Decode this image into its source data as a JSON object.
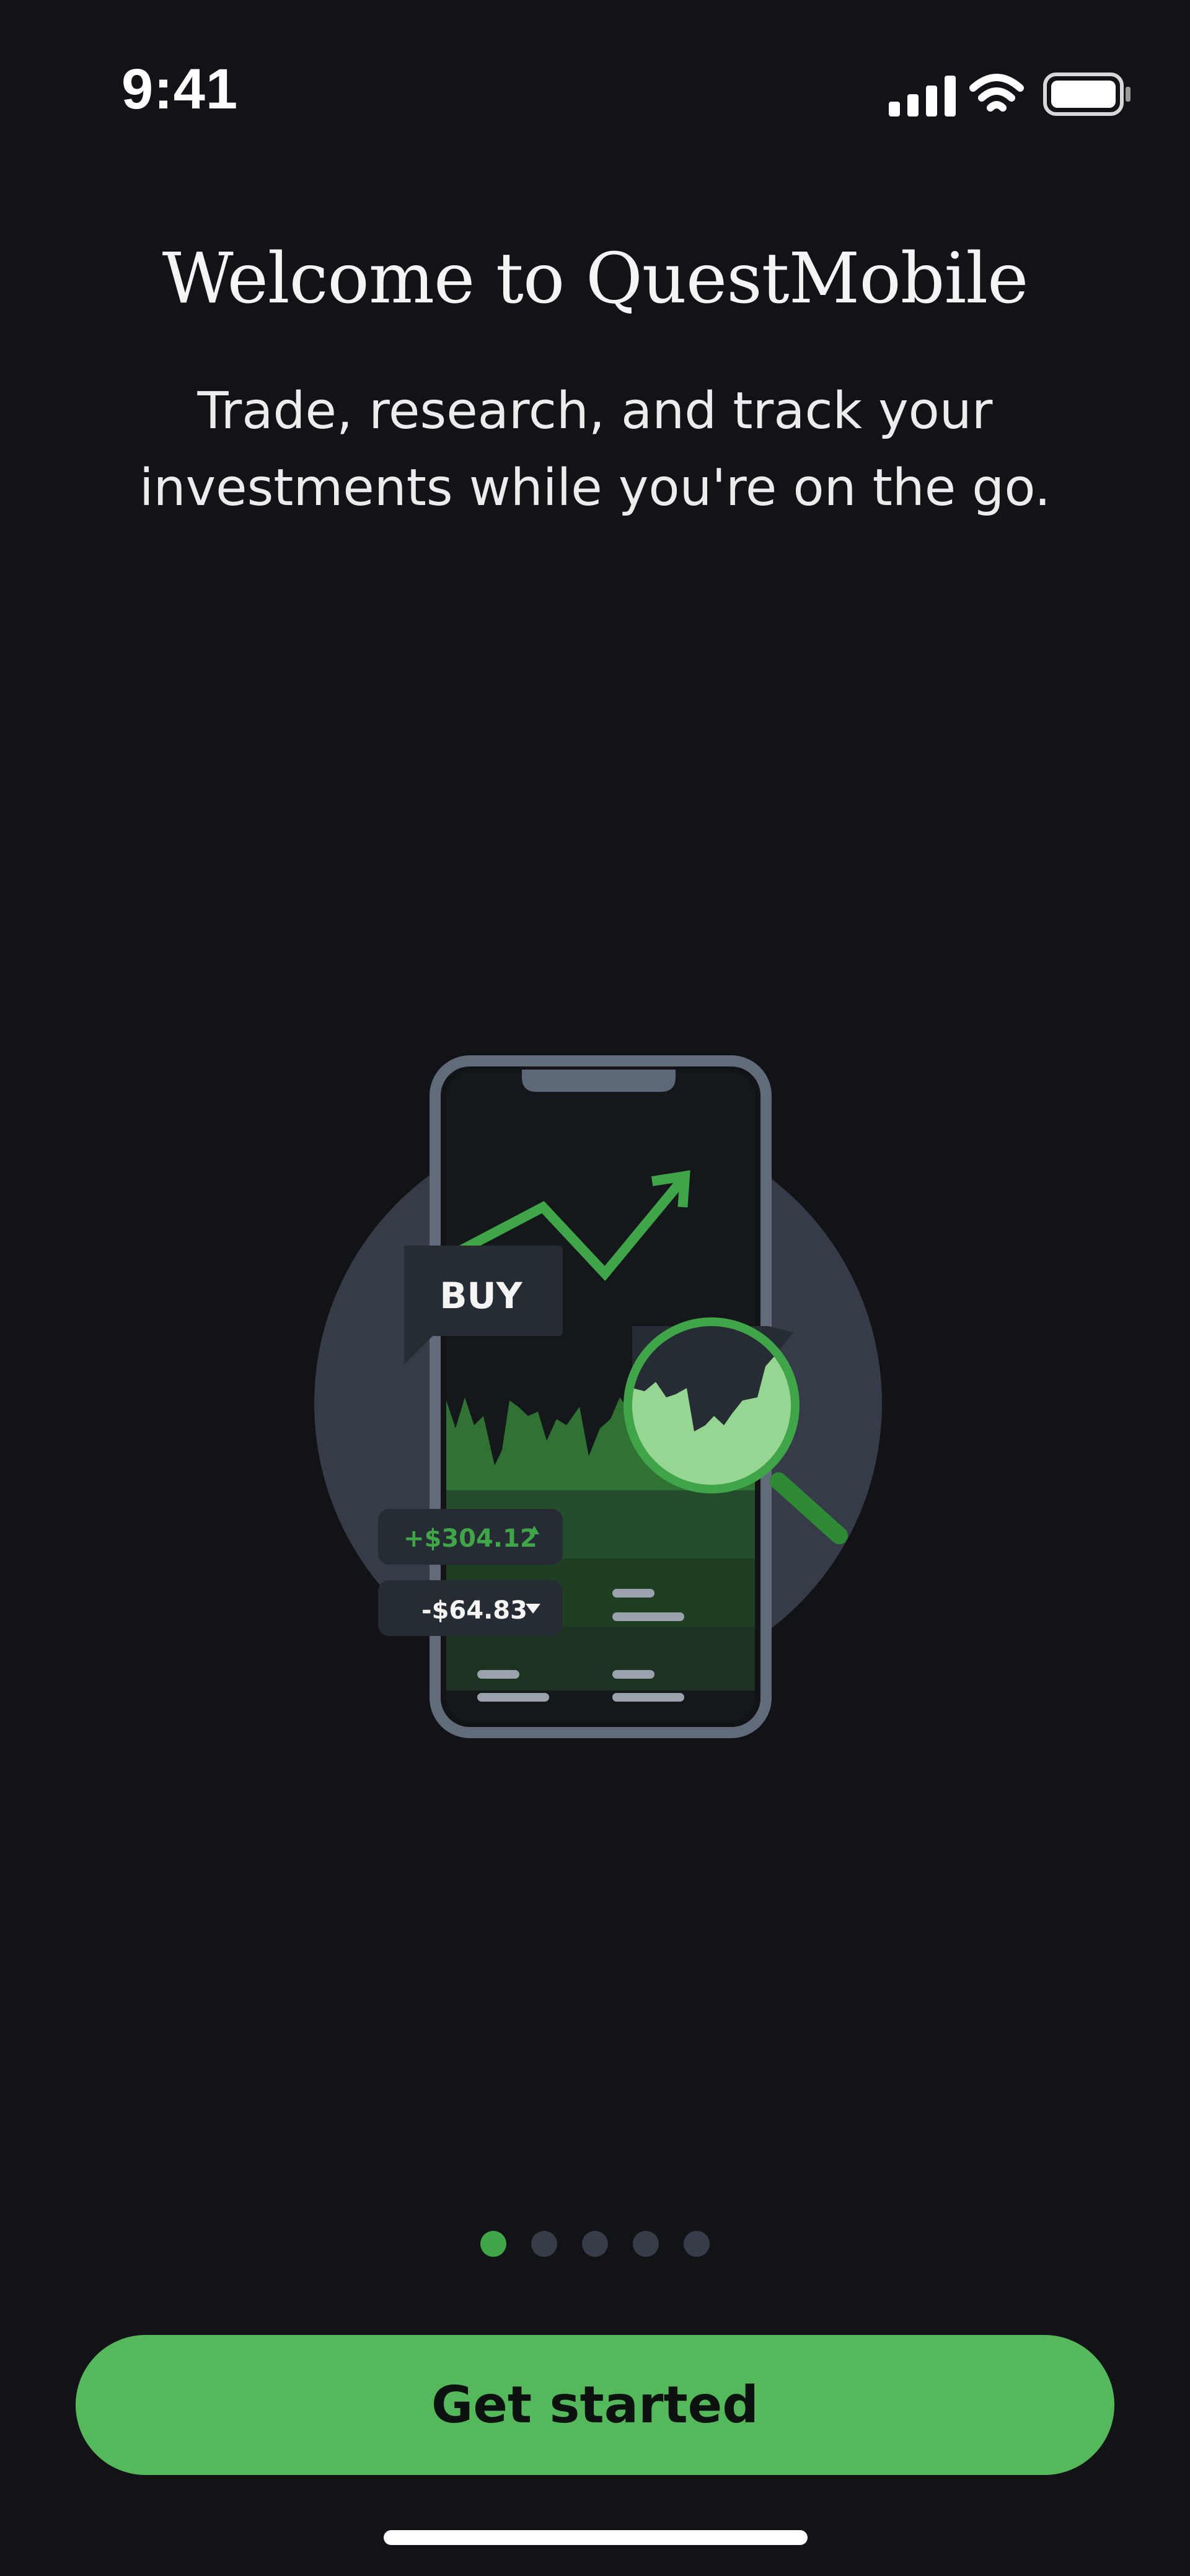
{
  "status_bar": {
    "time": "9:41"
  },
  "onboarding": {
    "title": "Welcome to QuestMobile",
    "subtitle": "Trade, research, and track your investments while you're on the go.",
    "current_page": 1,
    "page_count": 5,
    "cta_label": "Get started"
  },
  "illustration": {
    "buy_label": "BUY",
    "gain_label": "+$304.12",
    "loss_label": "-$64.83"
  },
  "colors": {
    "background": "#121316",
    "accent_green": "#55b95b",
    "dot_inactive": "#363c48"
  },
  "icons": [
    "cellular-signal-icon",
    "wifi-icon",
    "battery-icon",
    "triangle-up-icon",
    "triangle-down-icon",
    "magnifier-icon"
  ]
}
